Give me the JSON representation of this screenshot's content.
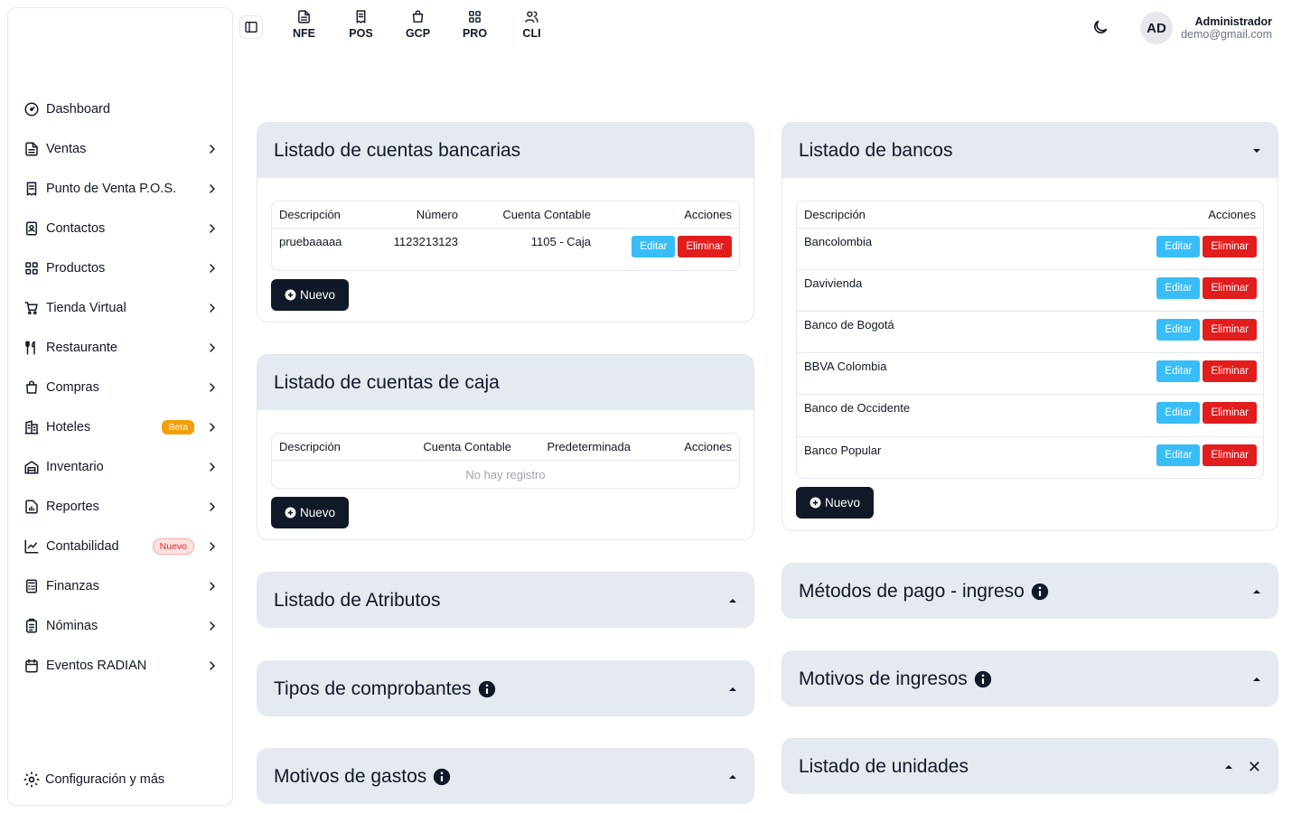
{
  "sidebar": {
    "items": [
      {
        "label": "Dashboard",
        "icon": "gauge-icon"
      },
      {
        "label": "Ventas",
        "icon": "file-text-icon"
      },
      {
        "label": "Punto de Venta P.O.S.",
        "icon": "receipt-icon"
      },
      {
        "label": "Contactos",
        "icon": "contacts-icon"
      },
      {
        "label": "Productos",
        "icon": "grid-icon"
      },
      {
        "label": "Tienda Virtual",
        "icon": "cart-icon"
      },
      {
        "label": "Restaurante",
        "icon": "utensils-icon"
      },
      {
        "label": "Compras",
        "icon": "shopping-bag-icon"
      },
      {
        "label": "Hoteles",
        "icon": "building-icon",
        "badge": "Beta"
      },
      {
        "label": "Inventario",
        "icon": "warehouse-icon"
      },
      {
        "label": "Reportes",
        "icon": "report-icon"
      },
      {
        "label": "Contabilidad",
        "icon": "chart-icon",
        "badge": "Nuevo"
      },
      {
        "label": "Finanzas",
        "icon": "calculator-icon"
      },
      {
        "label": "Nóminas",
        "icon": "payroll-icon"
      },
      {
        "label": "Eventos RADIAN",
        "icon": "calendar-icon"
      }
    ],
    "config_label": "Configuración y más"
  },
  "topnav": [
    {
      "label": "NFE",
      "icon": "invoice-icon"
    },
    {
      "label": "POS",
      "icon": "receipt-icon"
    },
    {
      "label": "GCP",
      "icon": "shopping-bag-icon"
    },
    {
      "label": "PRO",
      "icon": "grid-icon"
    },
    {
      "label": "CLI",
      "icon": "users-icon"
    }
  ],
  "user": {
    "initials": "AD",
    "name": "Administrador",
    "email": "demo@gmail.com"
  },
  "cuentas_bancarias": {
    "title": "Listado de cuentas bancarias",
    "headers": [
      "Descripción",
      "Número",
      "Cuenta Contable",
      "Acciones"
    ],
    "rows": [
      {
        "descripcion": "pruebaaaaa",
        "numero": "1123213123",
        "cuenta": "1105 - Caja"
      }
    ]
  },
  "cuentas_caja": {
    "title": "Listado de cuentas de caja",
    "headers": [
      "Descripción",
      "Cuenta Contable",
      "Predeterminada",
      "Acciones"
    ],
    "empty": "No hay registro"
  },
  "bancos": {
    "title": "Listado de bancos",
    "headers": [
      "Descripción",
      "Acciones"
    ],
    "rows": [
      "Bancolombia",
      "Davivienda",
      "Banco de Bogotá",
      "BBVA Colombia",
      "Banco de Occidente",
      "Banco Popular"
    ]
  },
  "collapsed": {
    "atributos": "Listado de Atributos",
    "comprobantes": "Tipos de comprobantes",
    "gastos": "Motivos de gastos",
    "metodos_pago": "Métodos de pago - ingreso",
    "ingresos": "Motivos de ingresos",
    "unidades": "Listado de unidades"
  },
  "actions": {
    "edit": "Editar",
    "delete": "Eliminar",
    "new": "Nuevo"
  },
  "colors": {
    "edit": "#38bdf8",
    "delete": "#e11d1d",
    "dark": "#111827",
    "header_bg": "#e5e9f0",
    "beta": "#f59e0b"
  }
}
